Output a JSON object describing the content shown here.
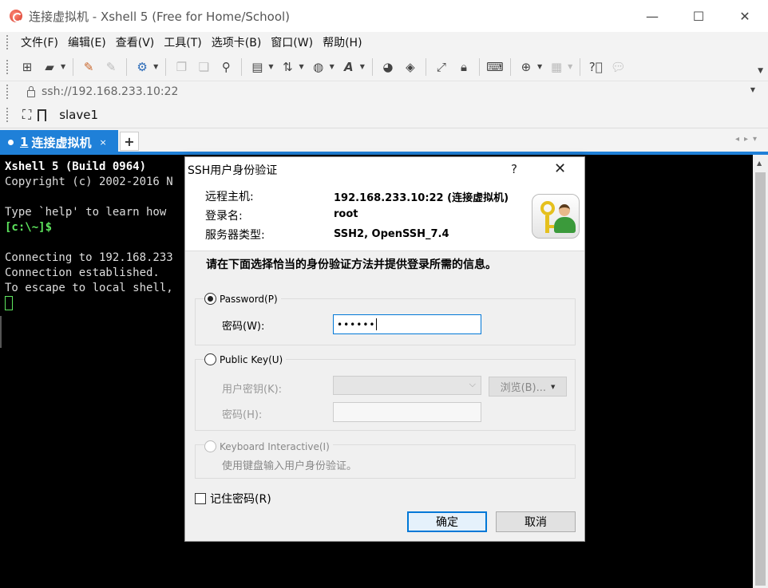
{
  "window": {
    "title": "连接虚拟机 - Xshell 5 (Free for Home/School)",
    "minimize_glyph": "—",
    "maximize_glyph": "☐",
    "close_glyph": "✕"
  },
  "menu": [
    "文件(F)",
    "编辑(E)",
    "查看(V)",
    "工具(T)",
    "选项卡(B)",
    "窗口(W)",
    "帮助(H)"
  ],
  "toolbar_icons": [
    "new-session-icon",
    "open-folder-icon",
    "reconnect-icon",
    "disconnect-icon",
    "properties-icon",
    "copy-icon",
    "paste-icon",
    "find-icon",
    "print-icon",
    "transfer-icon",
    "globe-icon",
    "font-icon",
    "xftp-icon",
    "xagent-icon",
    "fullscreen-icon",
    "lock-icon",
    "keyboard-icon",
    "add-icon",
    "layout-icon",
    "help-icon",
    "chat-icon"
  ],
  "address": {
    "value": "ssh://192.168.233.10:22"
  },
  "session": {
    "name": "slave1"
  },
  "tabs": [
    {
      "number": "1",
      "label": "连接虚拟机",
      "close": "×"
    }
  ],
  "tab_add": "+",
  "terminal": {
    "lines": [
      "Xshell 5 (Build 0964)",
      "Copyright (c) 2002-2016 N",
      "",
      "Type `help' to learn how",
      "[c:\\~]$",
      "",
      "Connecting to 192.168.233",
      "Connection established.",
      "To escape to local shell,"
    ]
  },
  "dialog": {
    "title": "SSH用户身份验证",
    "help": "?",
    "close": "✕",
    "remote_host_label": "远程主机:",
    "remote_host_value": "192.168.233.10:22 (连接虚拟机)",
    "login_label": "登录名:",
    "login_value": "root",
    "server_type_label": "服务器类型:",
    "server_type_value": "SSH2, OpenSSH_7.4",
    "instruction": "请在下面选择恰当的身份验证方法并提供登录所需的信息。",
    "password_option": "Password(P)",
    "password_label": "密码(W):",
    "password_value": "••••••",
    "pubkey_option": "Public Key(U)",
    "user_key_label": "用户密钥(K):",
    "browse_label": "浏览(B)...",
    "passphrase_label": "密码(H):",
    "keyboard_option": "Keyboard Interactive(I)",
    "keyboard_hint": "使用键盘输入用户身份验证。",
    "remember_label": "记住密码(R)",
    "ok_label": "确定",
    "cancel_label": "取消"
  },
  "colors": {
    "accent": "#1f80d8",
    "terminal_bg": "#000000",
    "prompt": "#5ee65e"
  }
}
